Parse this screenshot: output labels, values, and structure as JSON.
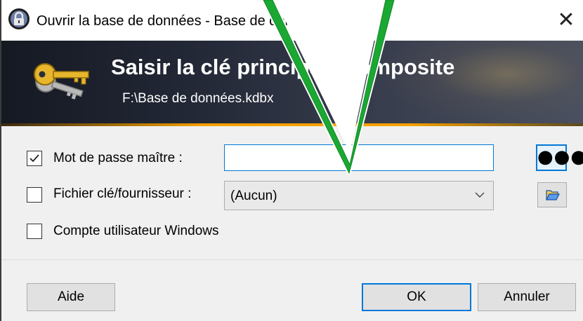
{
  "window": {
    "title": "Ouvrir la base de données - Base de données.kdbx",
    "close_glyph": "✕"
  },
  "banner": {
    "title": "Saisir la clé principale composite",
    "subtitle": "F:\\Base de données.kdbx"
  },
  "form": {
    "master_password": {
      "label": "Mot de passe maître :",
      "checked": true,
      "value": ""
    },
    "key_file": {
      "label": "Fichier clé/fournisseur :",
      "checked": false,
      "selected": "(Aucun)"
    },
    "windows_account": {
      "label": "Compte utilisateur Windows",
      "checked": false
    },
    "show_password_glyph": "●●●"
  },
  "buttons": {
    "help": "Aide",
    "ok": "OK",
    "cancel": "Annuler"
  },
  "icons": {
    "title": "lock-icon",
    "banner": "keys-icon",
    "chevron": "chevron-down-icon",
    "folder": "folder-open-icon",
    "overlay": "arrow-pointer-icon"
  },
  "colors": {
    "accent": "#0078d7",
    "banner_stripe": "#f5a000",
    "overlay_arrow": "#1aa832"
  }
}
